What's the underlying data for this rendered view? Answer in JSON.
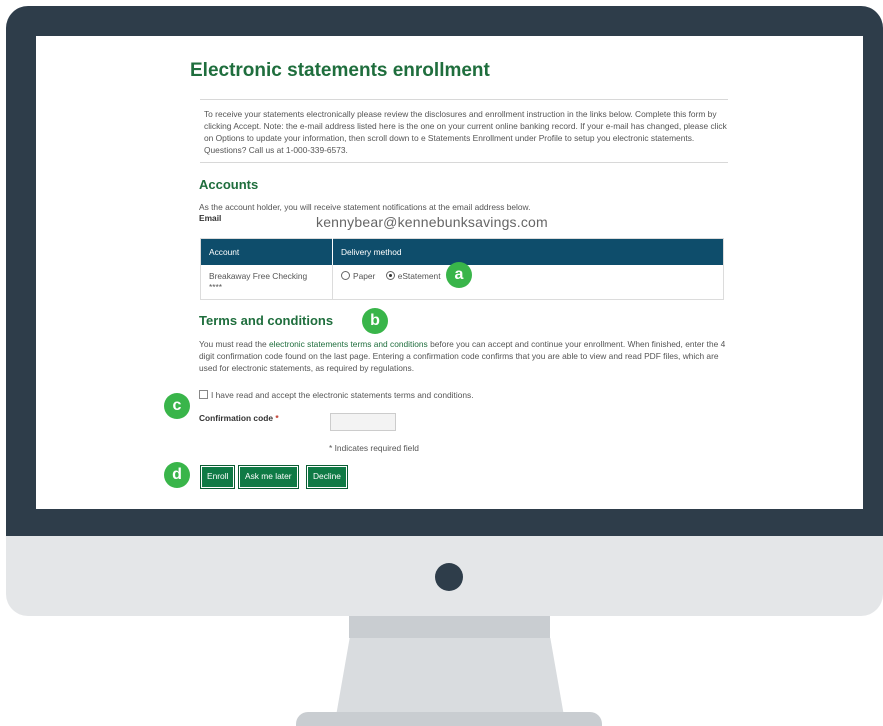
{
  "page": {
    "title": "Electronic statements enrollment",
    "intro": "To receive your statements electronically please review the disclosures and enrollment instruction in the links below. Complete this form by clicking Accept. Note: the e-mail address listed here is the one on your current online banking record. If your e-mail has changed, please click on Options to update your information, then scroll down to e Statements Enrollment under Profile to setup you electronic statements. Questions? Call us at 1-000-339-6573."
  },
  "accounts": {
    "heading": "Accounts",
    "note": "As the account holder, you will receive statement notifications at the email address below.",
    "email_label": "Email",
    "email_value": "kennybear@kennebunksavings.com",
    "table": {
      "headers": [
        "Account",
        "Delivery method"
      ],
      "rows": [
        {
          "account": "Breakaway Free Checking",
          "account_mask": "****",
          "options": [
            "Paper",
            "eStatement"
          ],
          "selected": "eStatement"
        }
      ]
    }
  },
  "terms": {
    "heading": "Terms and conditions",
    "text_before": "You must read the ",
    "link": "electronic statements terms and conditions",
    "text_after": " before you can accept and continue your enrollment. When finished, enter the 4 digit confirmation code found on the last page. Entering a confirmation code confirms that you are able to view and read PDF files, which are used for electronic statements, as required by regulations.",
    "checkbox_label": "I have read and accept the electronic statements terms and conditions.",
    "checkbox_checked": false,
    "code_label": "Confirmation code",
    "required_marker": "*",
    "code_value": "",
    "required_note": "* Indicates required field"
  },
  "buttons": {
    "enroll": "Enroll",
    "ask_later": "Ask me later",
    "decline": "Decline"
  },
  "callouts": {
    "a": "a",
    "b": "b",
    "c": "c",
    "d": "d"
  },
  "colors": {
    "bezel": "#2e3d4a",
    "brand_green": "#1f6e3d",
    "button_green": "#0f7a45",
    "table_header": "#0e4d6b",
    "callout": "#39b54a"
  }
}
